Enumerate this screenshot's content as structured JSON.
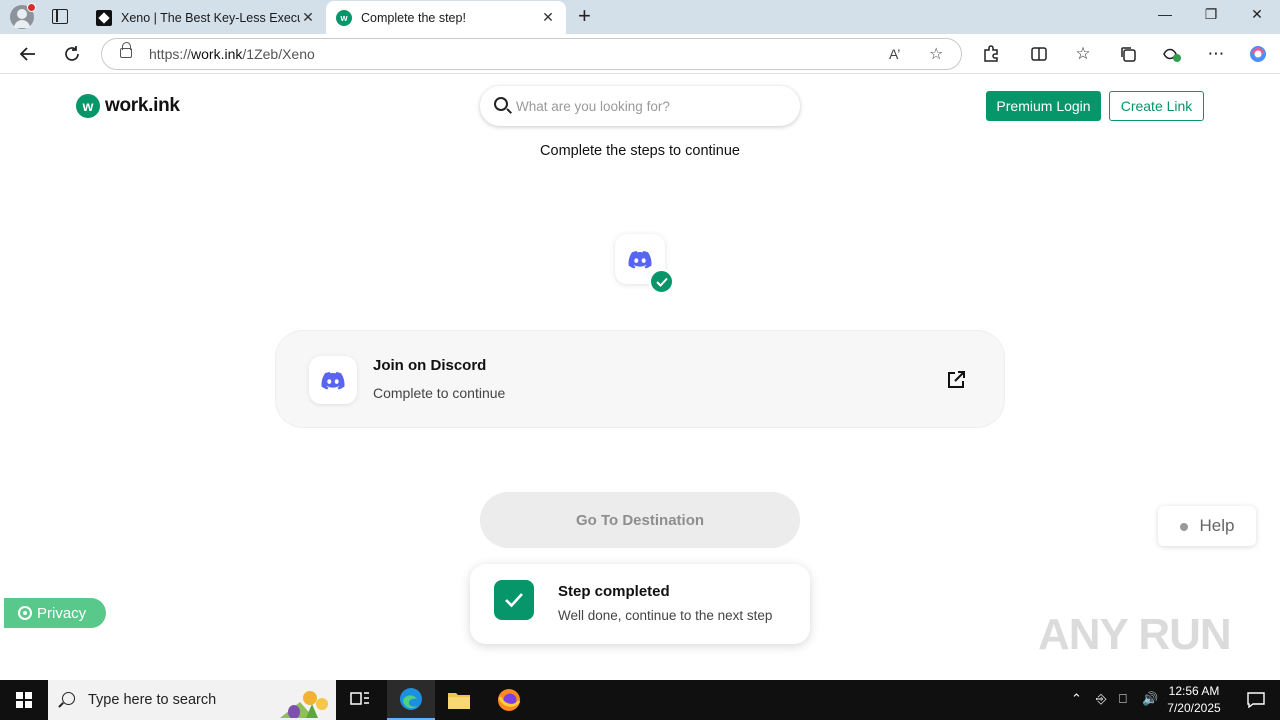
{
  "browser": {
    "tabs": [
      {
        "title": "Xeno | The Best Key-Less Executor",
        "active": false
      },
      {
        "title": "Complete the step!",
        "active": true
      }
    ],
    "url_prefix": "https://",
    "url_host": "work.ink",
    "url_path": "/1Zeb/Xeno"
  },
  "header": {
    "logo_mark": "w",
    "logo_text": "work.ink",
    "search_placeholder": "What are you looking for?",
    "premium_label": "Premium Login",
    "create_label": "Create Link"
  },
  "main": {
    "subtitle": "Complete the steps to continue",
    "step": {
      "title": "Join on Discord",
      "subtitle": "Complete to continue"
    },
    "destination_label": "Go To Destination"
  },
  "toast": {
    "title": "Step completed",
    "message": "Well done, continue to the next step"
  },
  "help_label": "Help",
  "privacy_label": "Privacy",
  "watermark": "ANY RUN",
  "taskbar": {
    "search_placeholder": "Type here to search",
    "time": "12:56 AM",
    "date": "7/20/2025"
  },
  "colors": {
    "brand_green": "#079669",
    "privacy_green": "#59c98b",
    "discord_blurple": "#5865f2"
  }
}
